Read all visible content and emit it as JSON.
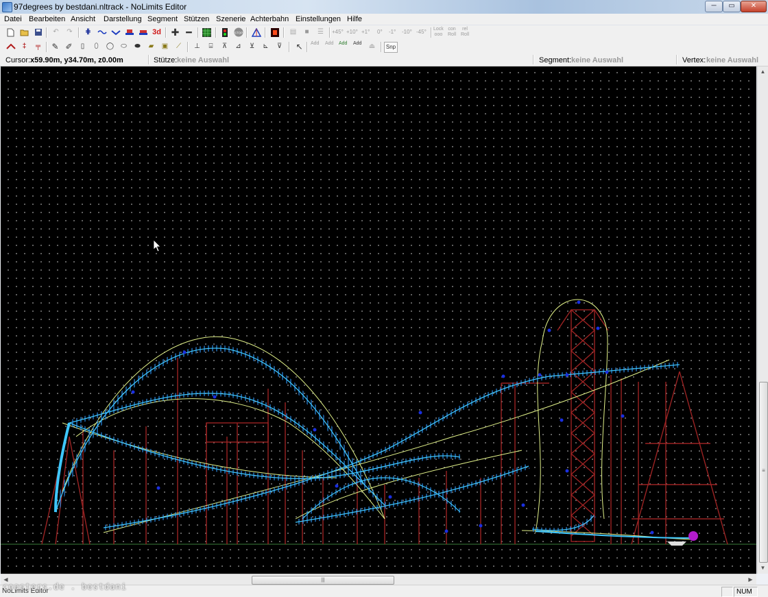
{
  "window": {
    "title": "97degrees by bestdani.nltrack - NoLimits Editor",
    "controls": [
      "─",
      "▭",
      "✕"
    ]
  },
  "menu": [
    "Datei",
    "Bearbeiten",
    "Ansicht",
    "Darstellung",
    "Segment",
    "Stützen",
    "Szenerie",
    "Achterbahn",
    "Einstellungen",
    "Hilfe"
  ],
  "toolbar1": {
    "labels": {
      "three_d": "3d",
      "stop": "STOP",
      "rot_p45": "+45°",
      "rot_p10": "+10°",
      "rot_p1": "+1°",
      "rot_0": "0°",
      "rot_m1": "-1°",
      "rot_m10": "-10°",
      "rot_m45": "-45°",
      "lock_roll": "Lock\nooo",
      "con_roll": "con\nRoll",
      "rel_roll": "rel\nRoll"
    }
  },
  "toolbar2": {
    "labels": {
      "add1": "Add",
      "add2": "Add",
      "add3": "Add",
      "add4": "Add",
      "snap": "Snp"
    }
  },
  "infobar": {
    "cursor_label": "Cursor:",
    "cursor_value": "x59.90m, y34.70m, z0.00m",
    "support_label": "Stütze:",
    "support_value": "keine Auswahl",
    "segment_label": "Segment:",
    "segment_value": "keine Auswahl",
    "vertex_label": "Vertex:",
    "vertex_value": "keine Auswahl"
  },
  "scrollbars": {
    "h_grip": "|||",
    "v_grip": "≡"
  },
  "status": {
    "left_text": "NoLimits Editor",
    "num": "NUM",
    "watermark": "coasters.de . bestdani"
  },
  "colors": {
    "viewport_bg": "#000000",
    "grid_dot": "#7b7b7b",
    "track_rail": "#3ec7ff",
    "track_ties": "#1f6fd8",
    "spline": "#e3f38a",
    "supports": "#9c2323",
    "vertex_node": "#1a2fe0",
    "ground_line": "#3d7b3d"
  }
}
